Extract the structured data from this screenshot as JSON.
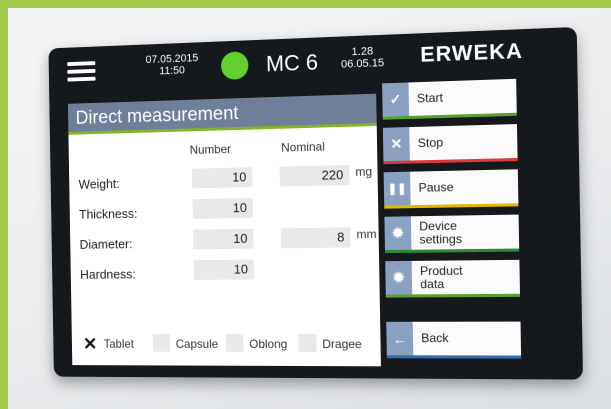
{
  "header": {
    "date": "07.05.2015",
    "time": "11:50",
    "device": "MC 6",
    "version": "1.28",
    "version_date": "06.05.15",
    "brand": "ERWEKA",
    "status_color": "#5fd12a"
  },
  "panel": {
    "title": "Direct measurement",
    "col_number": "Number",
    "col_nominal": "Nominal",
    "rows": [
      {
        "label": "Weight:",
        "number": "10",
        "nominal": "220",
        "unit": "mg"
      },
      {
        "label": "Thickness:",
        "number": "10"
      },
      {
        "label": "Diameter:",
        "number": "10",
        "nominal": "8",
        "unit": "mm"
      },
      {
        "label": "Hardness:",
        "number": "10"
      }
    ],
    "shapes": [
      {
        "label": "Tablet",
        "checked": true
      },
      {
        "label": "Capsule",
        "checked": false
      },
      {
        "label": "Oblong",
        "checked": false
      },
      {
        "label": "Dragee",
        "checked": false
      }
    ],
    "check_mark": "✕"
  },
  "buttons": {
    "start": {
      "label": "Start",
      "icon": "check-icon",
      "glyph": "✓",
      "color": "#5aa02c"
    },
    "stop": {
      "label": "Stop",
      "icon": "close-icon",
      "glyph": "✕",
      "color": "#d93a3a"
    },
    "pause": {
      "label": "Pause",
      "icon": "pause-icon",
      "glyph": "❚❚",
      "color": "#e5b800"
    },
    "device_settings": {
      "label": "Device settings",
      "icon": "gear-icon",
      "glyph": "✹",
      "color": "#2a8a3a"
    },
    "product_data": {
      "label": "Product data",
      "icon": "gear-icon",
      "glyph": "✹",
      "color": "#5aa02c"
    },
    "back": {
      "label": "Back",
      "icon": "back-arrow-icon",
      "glyph": "←",
      "color": "#2b6fb6"
    }
  }
}
